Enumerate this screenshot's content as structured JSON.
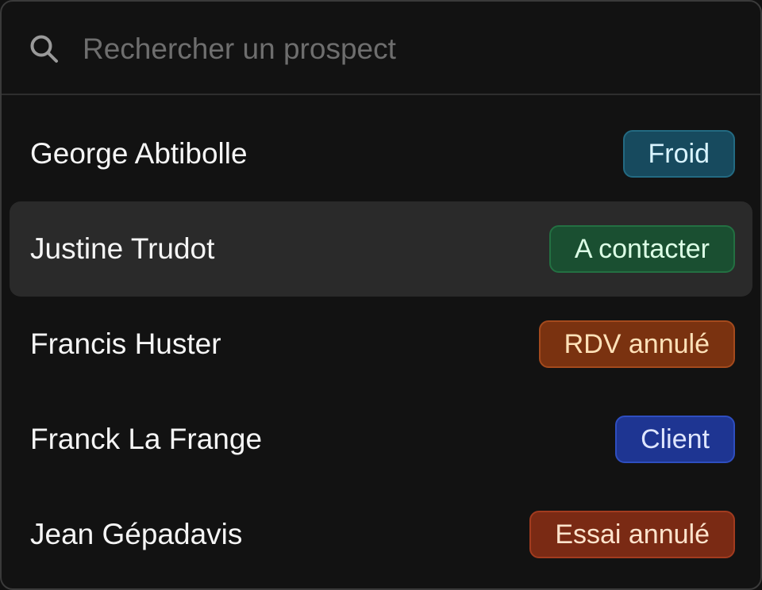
{
  "search": {
    "placeholder": "Rechercher un prospect",
    "value": ""
  },
  "prospects": [
    {
      "name": "George Abtibolle",
      "status": "Froid",
      "highlighted": false
    },
    {
      "name": "Justine Trudot",
      "status": "A contacter",
      "highlighted": true
    },
    {
      "name": "Francis Huster",
      "status": "RDV annulé",
      "highlighted": false
    },
    {
      "name": "Franck La Frange",
      "status": "Client",
      "highlighted": false
    },
    {
      "name": "Jean Gépadavis",
      "status": "Essai annulé",
      "highlighted": false
    }
  ],
  "colors": {
    "background": "#121212",
    "highlight": "#2a2a2a",
    "froid": "#174a5e",
    "a_contacter": "#1a4f31",
    "rdv_annule": "#7a3210",
    "client": "#1e3592",
    "essai_annule": "#7a2a14"
  },
  "icons": {
    "search": "search-icon"
  }
}
